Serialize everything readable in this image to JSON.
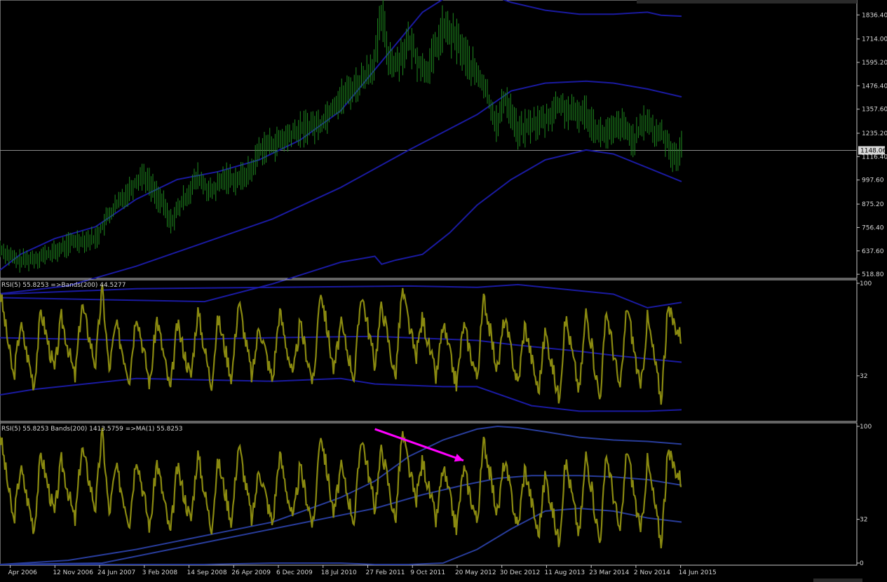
{
  "colors": {
    "background": "#000000",
    "frame": "#c8c8c8",
    "price_bars": "#1f8a1f",
    "bands_main": "#1a1aa0",
    "bands_sub": "#283c9a",
    "rsi_line": "#8a8a10",
    "arrow": "#ff00ff",
    "current_price_line": "#8c8c8c",
    "text": "#d8d8d8"
  },
  "chart_data": [
    {
      "type": "bar",
      "name": "price",
      "y_ticks": [
        "1836.40",
        "1714.00",
        "1595.20",
        "1476.40",
        "1357.60",
        "1235.20",
        "1116.40",
        "997.60",
        "875.20",
        "756.40",
        "637.60",
        "518.80"
      ],
      "y_tick_values": [
        1836.4,
        1714.0,
        1595.2,
        1476.4,
        1357.6,
        1235.2,
        1116.4,
        997.6,
        875.2,
        756.4,
        637.6,
        518.8
      ],
      "ylim": [
        505,
        1905
      ],
      "current_price_label": "1148.06",
      "current_price": 1148.06,
      "x_ticks": [
        "Apr 2006",
        "12 Nov 2006",
        "24 Jun 2007",
        "3 Feb 2008",
        "14 Sep 2008",
        "26 Apr 2009",
        "6 Dec 2009",
        "18 Jul 2010",
        "27 Feb 2011",
        "9 Oct 2011",
        "20 May 2012",
        "30 Dec 2012",
        "11 Aug 2013",
        "23 Mar 2014",
        "2 Nov 2014",
        "14 Jun 2015"
      ],
      "close_x": [
        0,
        0.025,
        0.05,
        0.08,
        0.11,
        0.14,
        0.16,
        0.19,
        0.21,
        0.24,
        0.25,
        0.27,
        0.29,
        0.31,
        0.33,
        0.35,
        0.37,
        0.38,
        0.39,
        0.41,
        0.43,
        0.45,
        0.47,
        0.49,
        0.51,
        0.53,
        0.55,
        0.56,
        0.57,
        0.58,
        0.6,
        0.62,
        0.63,
        0.65,
        0.67,
        0.69,
        0.71,
        0.73,
        0.74,
        0.75,
        0.76,
        0.78,
        0.8,
        0.82,
        0.84,
        0.86,
        0.88,
        0.9,
        0.91,
        0.93,
        0.95,
        0.96,
        0.97,
        0.98,
        0.99,
        1.0
      ],
      "close_y": [
        650,
        585,
        600,
        630,
        690,
        700,
        820,
        950,
        1030,
        870,
        780,
        900,
        1010,
        930,
        1010,
        1000,
        1050,
        1150,
        1170,
        1190,
        1230,
        1270,
        1280,
        1380,
        1440,
        1500,
        1600,
        1840,
        1630,
        1580,
        1700,
        1560,
        1570,
        1770,
        1710,
        1580,
        1480,
        1270,
        1420,
        1350,
        1240,
        1280,
        1300,
        1380,
        1330,
        1340,
        1230,
        1240,
        1280,
        1200,
        1310,
        1230,
        1240,
        1190,
        1100,
        1160
      ],
      "bands": [
        {
          "name": "upper",
          "x": [
            0,
            0.03,
            0.08,
            0.14,
            0.2,
            0.26,
            0.32,
            0.38,
            0.44,
            0.5,
            0.56,
            0.62,
            0.67,
            0.71,
            0.75,
            0.8,
            0.85,
            0.9,
            0.95,
            0.97,
            1.0
          ],
          "y": [
            540,
            620,
            700,
            760,
            900,
            1000,
            1040,
            1100,
            1200,
            1350,
            1600,
            1850,
            1960,
            1950,
            1900,
            1860,
            1840,
            1840,
            1850,
            1835,
            1830
          ]
        },
        {
          "name": "middle",
          "x": [
            0,
            0.1,
            0.2,
            0.3,
            0.4,
            0.5,
            0.6,
            0.7,
            0.75,
            0.8,
            0.86,
            0.9,
            0.95,
            1.0
          ],
          "y": [
            420,
            460,
            560,
            680,
            800,
            960,
            1150,
            1330,
            1450,
            1490,
            1500,
            1490,
            1460,
            1420
          ]
        },
        {
          "name": "lower",
          "x": [
            0,
            0.3,
            0.4,
            0.5,
            0.55,
            0.56,
            0.58,
            0.62,
            0.66,
            0.7,
            0.75,
            0.8,
            0.86,
            0.9,
            0.95,
            1.0
          ],
          "y": [
            400,
            380,
            470,
            580,
            610,
            570,
            590,
            620,
            730,
            870,
            1000,
            1100,
            1150,
            1130,
            1060,
            990
          ]
        }
      ]
    },
    {
      "type": "line",
      "name": "rsi_bands_panel",
      "label": "RSI(5) 55.8253 =>Bands(200) 44.5277",
      "y_ticks": [
        "100",
        "32"
      ],
      "y_tick_values": [
        100,
        32
      ],
      "ylim": [
        0,
        100
      ],
      "bands": [
        {
          "name": "upper",
          "x": [
            0,
            0.2,
            0.4,
            0.6,
            0.7,
            0.76,
            0.82,
            0.9,
            0.95,
            1.0
          ],
          "y": [
            92,
            96,
            97,
            98,
            97,
            99,
            96,
            92,
            82,
            86
          ]
        },
        {
          "name": "middle",
          "x": [
            0,
            0.2,
            0.4,
            0.55,
            0.65,
            0.7,
            0.75,
            0.85,
            0.9,
            1.0
          ],
          "y": [
            60,
            58,
            60,
            61,
            59,
            58,
            55,
            50,
            47,
            42
          ]
        },
        {
          "name": "lower",
          "x": [
            0,
            0.05,
            0.2,
            0.4,
            0.5,
            0.55,
            0.65,
            0.7,
            0.78,
            0.85,
            0.95,
            1.0
          ],
          "y": [
            18,
            22,
            30,
            28,
            30,
            26,
            24,
            24,
            10,
            6,
            6,
            7
          ]
        }
      ]
    },
    {
      "type": "line",
      "name": "rsi_ma_panel",
      "label": "RSI(5) 55.8253 Bands(200) 1413.5759 =>MA(1) 55.8253",
      "y_ticks": [
        "100",
        "32",
        "0"
      ],
      "y_tick_values": [
        100,
        32,
        0
      ],
      "ylim": [
        0,
        100
      ],
      "bands": [
        {
          "name": "upper",
          "x": [
            0,
            0.1,
            0.2,
            0.3,
            0.4,
            0.5,
            0.55,
            0.6,
            0.65,
            0.7,
            0.73,
            0.76,
            0.8,
            0.85,
            0.9,
            0.95,
            1.0
          ],
          "y": [
            -5,
            2,
            10,
            20,
            30,
            48,
            60,
            78,
            90,
            98,
            100,
            99,
            96,
            92,
            90,
            89,
            87
          ]
        },
        {
          "name": "middle",
          "x": [
            0,
            0.15,
            0.25,
            0.35,
            0.45,
            0.55,
            0.62,
            0.68,
            0.73,
            0.78,
            0.85,
            0.9,
            0.95,
            1.0
          ],
          "y": [
            -10,
            0,
            10,
            20,
            30,
            40,
            50,
            57,
            62,
            64,
            64,
            63,
            61,
            57
          ]
        },
        {
          "name": "lower",
          "x": [
            0,
            0.1,
            0.3,
            0.4,
            0.5,
            0.55,
            0.6,
            0.65,
            0.7,
            0.75,
            0.8,
            0.85,
            0.9,
            0.95,
            1.0
          ],
          "y": [
            -20,
            -15,
            -5,
            0,
            0,
            -3,
            -5,
            0,
            10,
            25,
            38,
            40,
            38,
            33,
            30
          ]
        }
      ],
      "annotation_arrow": {
        "from_x": 0.55,
        "from_y": 98,
        "to_x": 0.68,
        "to_y": 75
      }
    }
  ],
  "rsi_series": {
    "x": [
      0,
      0.02,
      0.03,
      0.05,
      0.06,
      0.08,
      0.09,
      0.11,
      0.12,
      0.14,
      0.15,
      0.16,
      0.17,
      0.19,
      0.2,
      0.22,
      0.23,
      0.25,
      0.26,
      0.28,
      0.29,
      0.31,
      0.32,
      0.34,
      0.35,
      0.37,
      0.38,
      0.4,
      0.41,
      0.43,
      0.44,
      0.46,
      0.47,
      0.49,
      0.5,
      0.52,
      0.53,
      0.55,
      0.56,
      0.58,
      0.59,
      0.61,
      0.62,
      0.64,
      0.65,
      0.67,
      0.68,
      0.7,
      0.71,
      0.73,
      0.74,
      0.76,
      0.77,
      0.79,
      0.8,
      0.82,
      0.83,
      0.85,
      0.86,
      0.88,
      0.89,
      0.91,
      0.92,
      0.94,
      0.95,
      0.97,
      0.98,
      1.0
    ],
    "y": [
      95,
      30,
      70,
      25,
      80,
      35,
      75,
      30,
      85,
      40,
      98,
      35,
      70,
      30,
      80,
      25,
      75,
      20,
      70,
      30,
      80,
      25,
      75,
      30,
      88,
      30,
      70,
      28,
      80,
      30,
      70,
      25,
      98,
      35,
      70,
      30,
      95,
      40,
      85,
      30,
      95,
      45,
      75,
      30,
      70,
      25,
      70,
      30,
      90,
      35,
      75,
      25,
      70,
      20,
      65,
      15,
      75,
      20,
      80,
      15,
      80,
      20,
      85,
      20,
      75,
      15,
      80,
      60
    ]
  }
}
